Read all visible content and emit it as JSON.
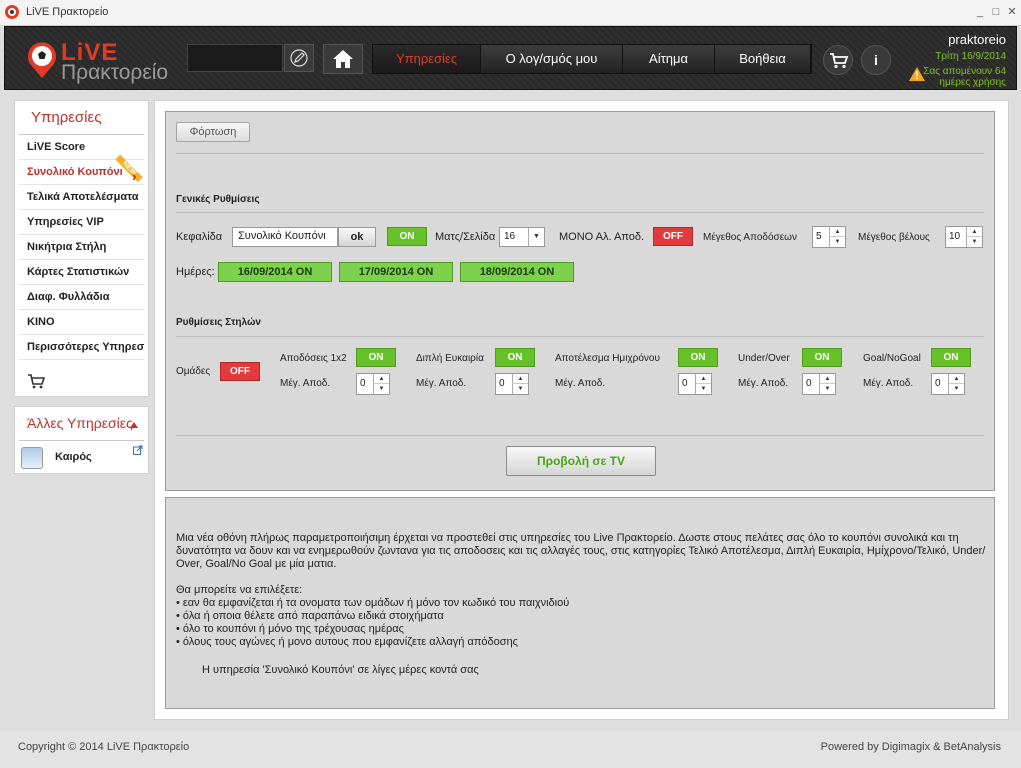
{
  "window": {
    "title": "LiVE Πρακτορείο",
    "minimize": "_",
    "maximize": "□",
    "close": "✕"
  },
  "header": {
    "logo_live": "LiVE",
    "logo_praktoreio": "Πρακτορείο",
    "search_value": "",
    "nav": [
      {
        "label": "Υπηρεσίες",
        "active": true
      },
      {
        "label": "Ο λογ/σμός μου",
        "active": false
      },
      {
        "label": "Αίτημα",
        "active": false
      },
      {
        "label": "Βοήθεια",
        "active": false
      }
    ],
    "info_label": "i",
    "username": "praktoreio",
    "date": "Τρίτη 16/9/2014",
    "expire_notice": "Σας απομένουν 64 ημέρες χρήσης"
  },
  "sidebar": {
    "title": "Υπηρεσίες",
    "new_badge": "NEW",
    "items": [
      {
        "label": "LiVE Score",
        "active": false
      },
      {
        "label": "Συνολικό Κουπόνι",
        "active": true
      },
      {
        "label": "Τελικά Αποτελέσματα",
        "active": false
      },
      {
        "label": "Υπηρεσίες VIP",
        "active": false
      },
      {
        "label": "Νικήτρια Στήλη",
        "active": false
      },
      {
        "label": "Κάρτες Στατιστικών",
        "active": false
      },
      {
        "label": "Διαφ. Φυλλάδια",
        "active": false
      },
      {
        "label": "KINO",
        "active": false
      },
      {
        "label": "Περισσότερες Υπηρεσίες",
        "active": false
      }
    ],
    "other_title": "Άλλες Υπηρεσίες",
    "other_items": [
      {
        "label": "Καιρός"
      }
    ]
  },
  "settings": {
    "load_button": "Φόρτωση",
    "general_title": "Γενικές Ρυθμίσεις",
    "header_label": "Κεφαλίδα",
    "header_value": "Συνολικό Κουπόνι",
    "ok_label": "ok",
    "header_toggle": "ON",
    "per_page_label": "Ματς/Σελίδα",
    "per_page_value": "16",
    "mono_label": "ΜΟΝΟ Αλ. Αποδ.",
    "mono_toggle": "OFF",
    "odds_size_label": "Μέγεθος Αποδόσεων",
    "odds_size_value": "5",
    "arrow_size_label": "Μέγεθος βέλους",
    "arrow_size_value": "10",
    "days_label": "Ημέρες:",
    "days": [
      "16/09/2014 ON",
      "17/09/2014 ON",
      "18/09/2014 ON"
    ],
    "columns_title": "Ρυθμίσεις Στηλών",
    "teams_label": "Ομάδες",
    "teams_toggle": "OFF",
    "columns": [
      {
        "label": "Αποδόσεις 1x2",
        "toggle": "ON",
        "max_label": "Μέγ. Αποδ.",
        "max_value": "0"
      },
      {
        "label": "Διπλή Ευκαιρία",
        "toggle": "ON",
        "max_label": "Μέγ. Αποδ.",
        "max_value": "0"
      },
      {
        "label": "Αποτέλεσμα Ημιχρόνου",
        "toggle": "ON",
        "max_label": "Μέγ. Αποδ.",
        "max_value": "0"
      },
      {
        "label": "Under/Over",
        "toggle": "ON",
        "max_label": "Μέγ. Αποδ.",
        "max_value": "0"
      },
      {
        "label": "Goal/NoGoal",
        "toggle": "ON",
        "max_label": "Μέγ. Αποδ.",
        "max_value": "0"
      }
    ],
    "tv_button": "Προβολή σε TV"
  },
  "info": {
    "paragraph": "Μια νέα οθόνη πλήρως παραμετροποιήσιμη έρχεται να προστεθεί στις υπηρεσίες του Live Πρακτορείο. Δωστε  στους πελάτες σας όλο το κουπόνι συνολικά και τη δυνατότητα να δουν και να ενημερωθούν ζωντανα για τις αποδοσεις και τις αλλαγές τους, στις κατηγορίες Τελικό Αποτέλεσμα, Διπλή Ευκαιρία, Ημίχρονο/Τελικό, Under/ Over, Goal/No Goal με μία ματια.",
    "choose_title": "Θα μπορείτε να επιλέξετε:",
    "bullets": [
      "• εαν θα εμφανίζεται ή τα ονοματα των ομάδων ή μόνο τον κωδικό του παιχνιδιού",
      "• όλα ή οποια θέλετε από παραπάνω ειδικά στοιχήματα",
      "• όλο το κουπόνι ή μόνο της τρέχουσας ημέρας",
      "• όλους τους αγώνες ή μονο αυτους που εμφανίζετε αλλαγή απόδοσης"
    ],
    "soon": "Η υπηρεσία 'Συνολικό Κουπόνι' σε λίγες μέρες κοντά σας"
  },
  "footer": {
    "copyright": "Copyright © 2014 LiVE Πρακτορείο",
    "powered": "Powered by  Digimagix  & BetAnalysis"
  },
  "colors": {
    "accent_red": "#c0312a",
    "on_green": "#66c12a",
    "off_red": "#e33b3b",
    "date_green": "#7ec41f"
  }
}
